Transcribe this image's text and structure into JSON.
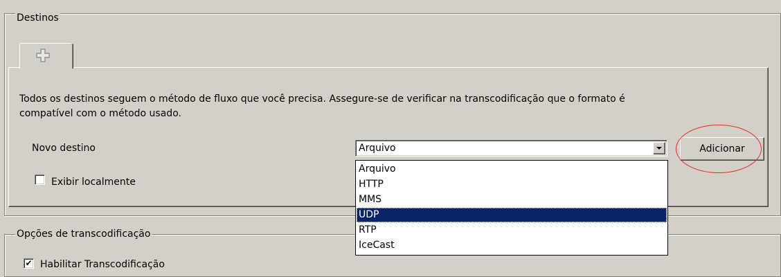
{
  "destinations": {
    "group_title": "Destinos",
    "tab_icon": "plus-icon",
    "description": [
      "Todos os destinos seguem o método de fluxo que você precisa. Assegure-se de verificar na transcodificação que o formato é",
      "compatível com o método usado."
    ],
    "new_destination_label": "Novo destino",
    "combo_value": "Arquivo",
    "dropdown_options": [
      "Arquivo",
      "HTTP",
      "MMS",
      "UDP",
      "RTP",
      "IceCast"
    ],
    "dropdown_highlighted": "UDP",
    "add_button_label": "Adicionar",
    "display_locally": {
      "label": "Exibir localmente",
      "checked": false
    }
  },
  "transcoding": {
    "group_title": "Opções de transcodificação",
    "enable": {
      "label": "Habilitar Transcodificação",
      "checked": true
    }
  },
  "colors": {
    "window_bg": "#d4d0c8",
    "selection_bg": "#0a246a",
    "annotation": "#e03030"
  }
}
